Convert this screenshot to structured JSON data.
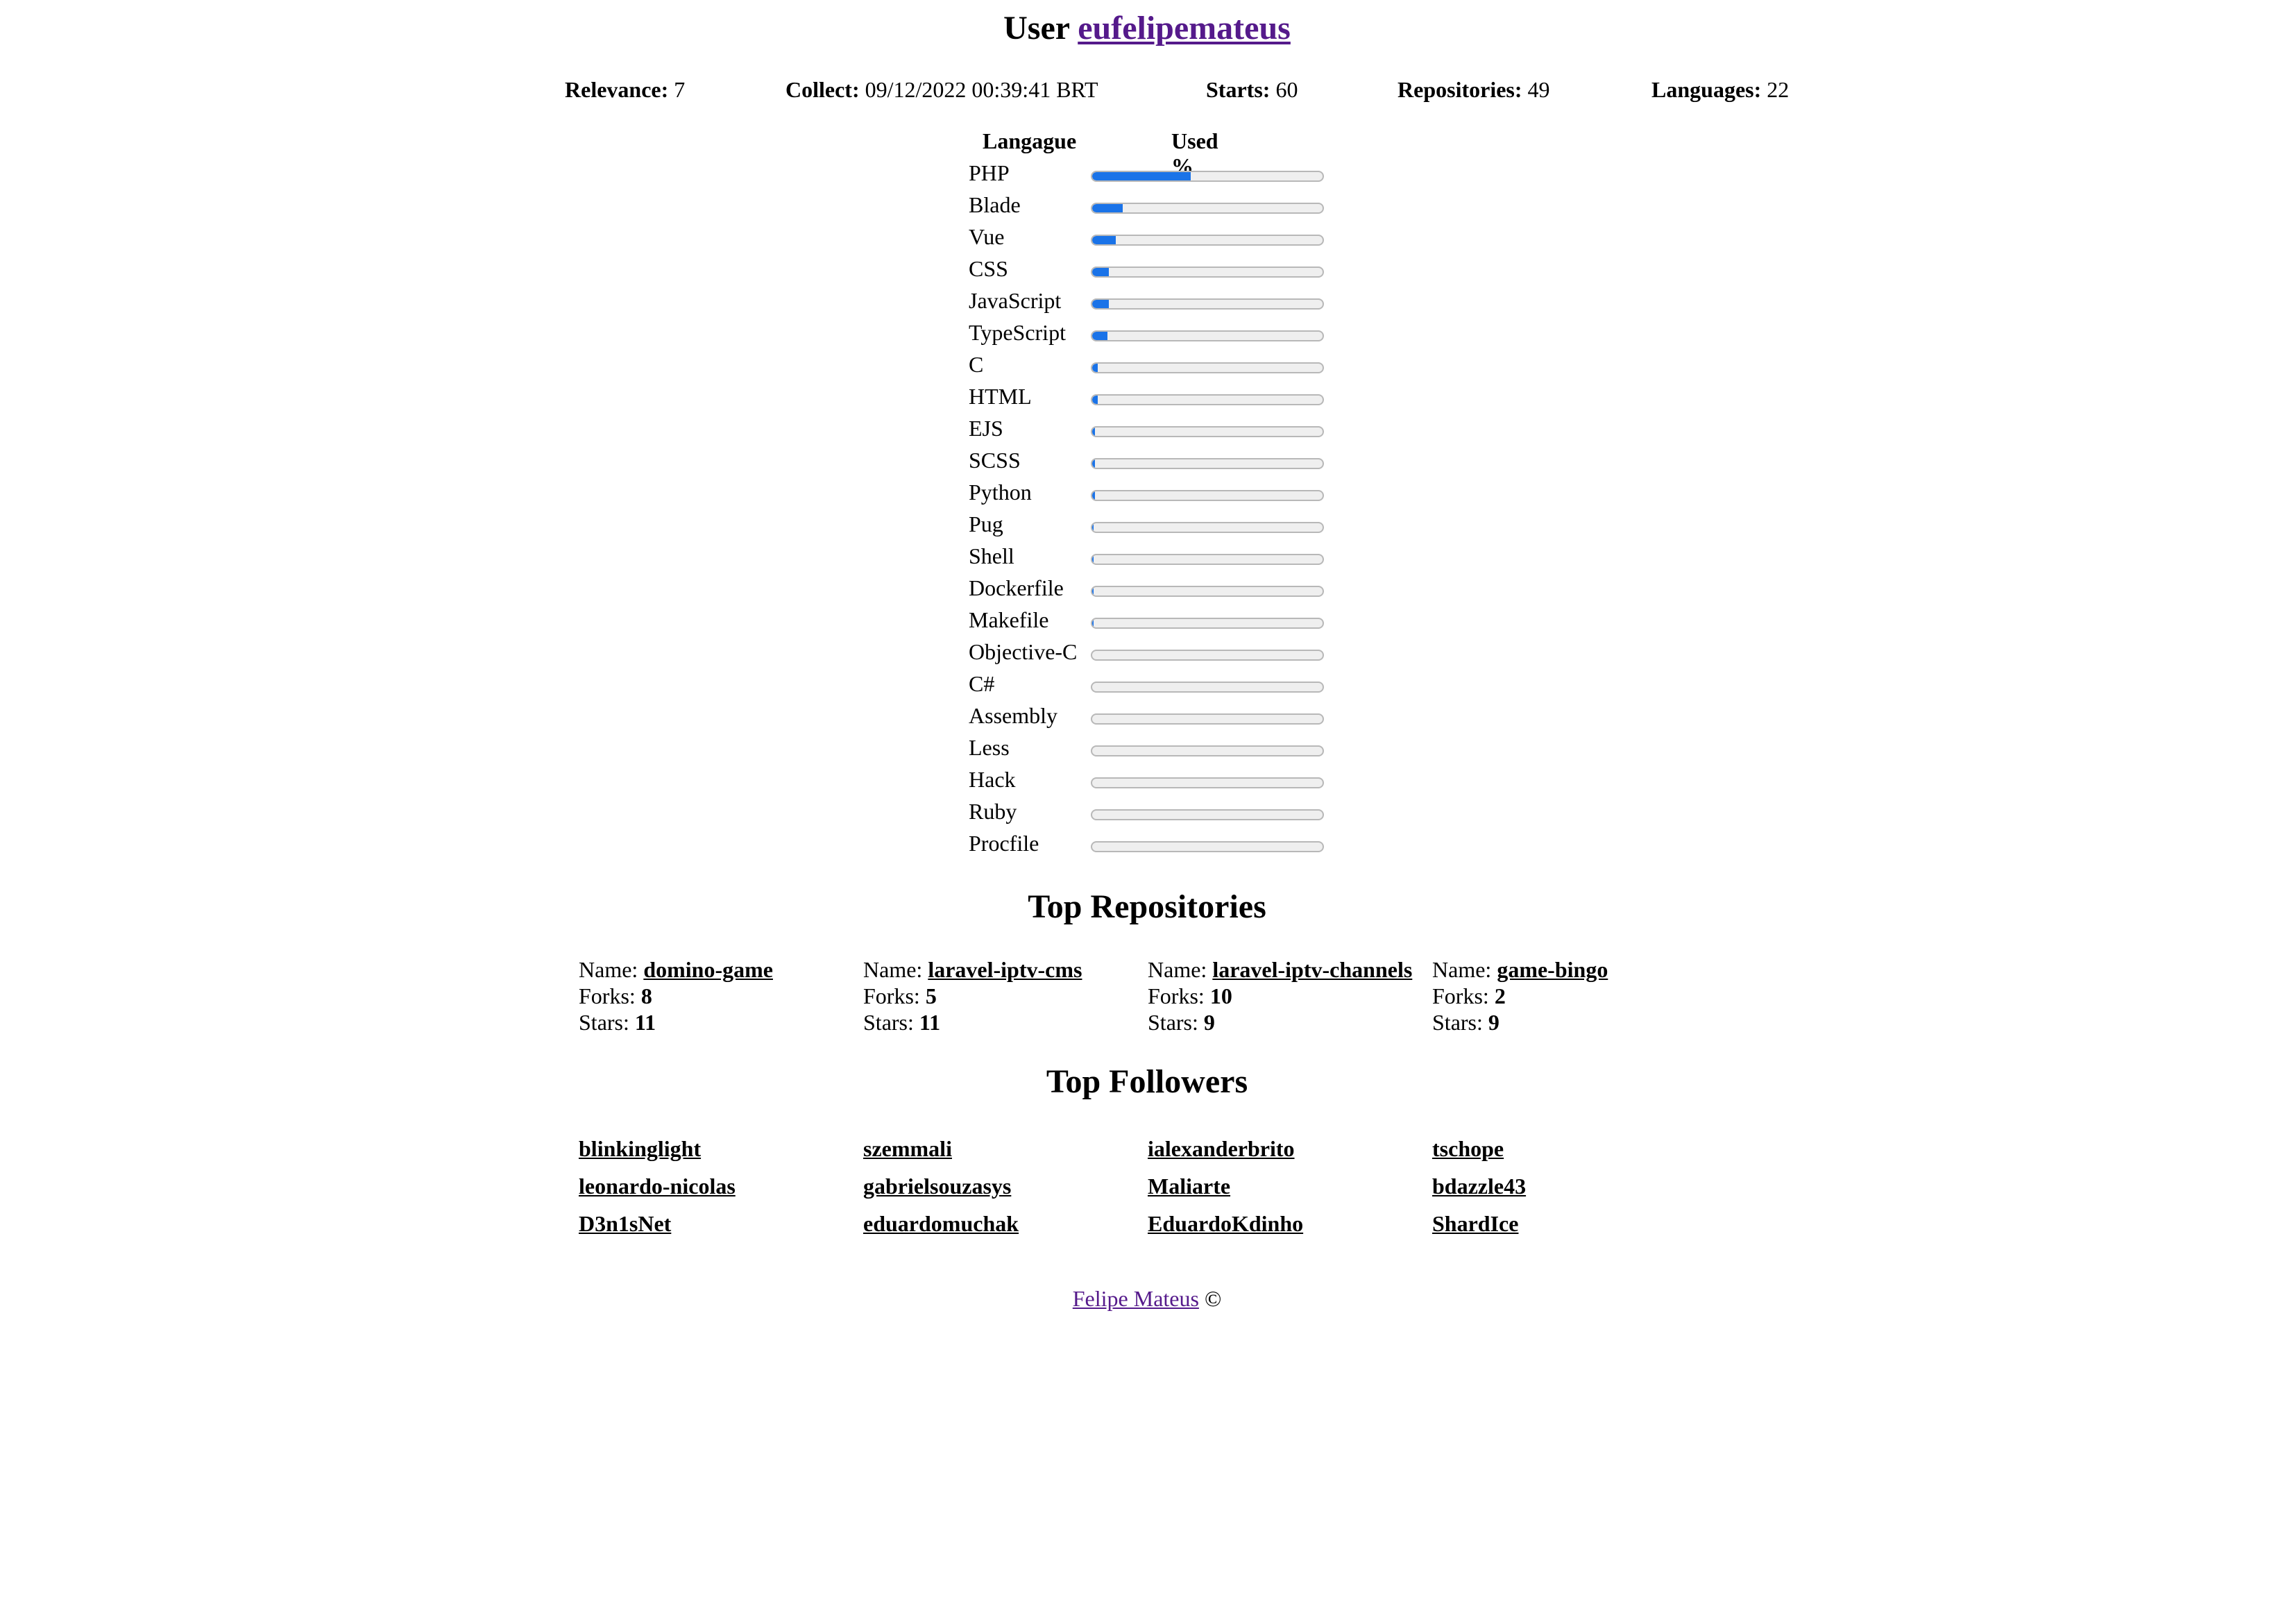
{
  "header": {
    "prefix": "User",
    "username": "eufelipemateus"
  },
  "stats": [
    {
      "label": "Relevance:",
      "value": "7"
    },
    {
      "label": "Collect:",
      "value": "09/12/2022 00:39:41 BRT"
    },
    {
      "label": "Starts:",
      "value": "60"
    },
    {
      "label": "Repositories:",
      "value": "49"
    },
    {
      "label": "Languages:",
      "value": "22"
    }
  ],
  "languages": {
    "col_language": "Langague",
    "col_used": "Used %",
    "items": [
      {
        "name": "PHP",
        "pct": 43
      },
      {
        "name": "Blade",
        "pct": 13
      },
      {
        "name": "Vue",
        "pct": 10
      },
      {
        "name": "CSS",
        "pct": 7.5
      },
      {
        "name": "JavaScript",
        "pct": 7
      },
      {
        "name": "TypeScript",
        "pct": 6.5
      },
      {
        "name": "C",
        "pct": 2.5
      },
      {
        "name": "HTML",
        "pct": 2.5
      },
      {
        "name": "EJS",
        "pct": 1.2
      },
      {
        "name": "SCSS",
        "pct": 1
      },
      {
        "name": "Python",
        "pct": 1
      },
      {
        "name": "Pug",
        "pct": 0.2
      },
      {
        "name": "Shell",
        "pct": 0.1
      },
      {
        "name": "Dockerfile",
        "pct": 0.1
      },
      {
        "name": "Makefile",
        "pct": 0.1
      },
      {
        "name": "Objective-C",
        "pct": 0
      },
      {
        "name": "C#",
        "pct": 0
      },
      {
        "name": "Assembly",
        "pct": 0
      },
      {
        "name": "Less",
        "pct": 0
      },
      {
        "name": "Hack",
        "pct": 0
      },
      {
        "name": "Ruby",
        "pct": 0
      },
      {
        "name": "Procfile",
        "pct": 0
      }
    ]
  },
  "top_repositories": {
    "title": "Top Repositories",
    "name_label": "Name:",
    "forks_label": "Forks:",
    "stars_label": "Stars:",
    "items": [
      {
        "name": "domino-game",
        "forks": "8",
        "stars": "11"
      },
      {
        "name": "laravel-iptv-cms",
        "forks": "5",
        "stars": "11"
      },
      {
        "name": "laravel-iptv-channels",
        "forks": "10",
        "stars": "9"
      },
      {
        "name": "game-bingo",
        "forks": "2",
        "stars": "9"
      }
    ]
  },
  "top_followers": {
    "title": "Top Followers",
    "items": [
      "blinkinglight",
      "szemmali",
      "ialexanderbrito",
      "tschope",
      "leonardo-nicolas",
      "gabrielsouzasys",
      "Maliarte",
      "bdazzle43",
      "D3n1sNet",
      "eduardomuchak",
      "EduardoKdinho",
      "ShardIce"
    ]
  },
  "footer": {
    "author": "Felipe Mateus",
    "copyright": "©"
  },
  "colors": {
    "bar_fill": "#1a73e8",
    "bar_track": "#efefef",
    "link_visited": "#551a8b"
  }
}
